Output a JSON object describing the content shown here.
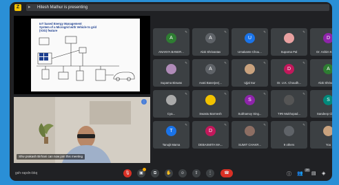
{
  "header": {
    "app_badge": "Z",
    "presenting": "Hitesh Mathur is presenting"
  },
  "slide": {
    "title": "IoT based Energy Management\nSystem of a Microgrid with Vehicle to grid\n(V2G) feature"
  },
  "speaker": {
    "caption": "Shiv prakash Birhani can now join this meeting"
  },
  "participants": [
    {
      "initial": "A",
      "name": "ANANYA BANER...",
      "color": "#2e7d32"
    },
    {
      "initial": "A",
      "name": "Alok Shrivastav",
      "color": "#5f6368"
    },
    {
      "initial": "U",
      "name": "Umakante Chou...",
      "color": "#1a73e8"
    },
    {
      "initial": "",
      "name": "Suparna Pal",
      "color": "#e8a0a0",
      "photo": true
    },
    {
      "initial": "D",
      "name": "Dr. Ashim Kuma...",
      "color": "#8e24aa"
    },
    {
      "initial": "",
      "name": "Suparna Biswas",
      "color": "#b08bb8",
      "photo": true
    },
    {
      "initial": "A",
      "name": "Avati Banerjee(...",
      "color": "#5f6368"
    },
    {
      "initial": "",
      "name": "Ujjal Sur",
      "color": "#c9a27e",
      "photo": true
    },
    {
      "initial": "D",
      "name": "Dr. U.K. Choudh...",
      "color": "#c2185b"
    },
    {
      "initial": "A",
      "name": "Alok Shrivastav",
      "color": "#2e7d32"
    },
    {
      "initial": "",
      "name": "Cya...",
      "color": "#aaaaaa",
      "photo": true
    },
    {
      "initial": "",
      "name": "Swastu Barmesh",
      "color": "#f2c200",
      "photo": true
    },
    {
      "initial": "S",
      "name": "Subhamoy Sing...",
      "color": "#8e24aa"
    },
    {
      "initial": "",
      "name": "TIRI Mukhopad...",
      "color": "#555",
      "photo": true
    },
    {
      "initial": "S",
      "name": "Sandeep Chakr...",
      "color": "#00897b"
    },
    {
      "initial": "T",
      "name": "Tanujit Mama",
      "color": "#1a73e8"
    },
    {
      "initial": "D",
      "name": "DEBASMITA MA...",
      "color": "#c2185b"
    },
    {
      "initial": "",
      "name": "SUMIT CHAKR...",
      "color": "#8d6e63",
      "photo": true
    },
    {
      "initial": "",
      "name": "9 others",
      "color": "#5f6368",
      "photo": true
    },
    {
      "initial": "",
      "name": "You",
      "color": "#c9a27e",
      "photo": true
    }
  ],
  "footer": {
    "meeting_code": "gsh-rapdn-bkq",
    "host_badge": "20"
  },
  "icons": {
    "mic": "mic-off-icon",
    "camera": "camera-icon",
    "captions": "captions-icon",
    "hand": "raise-hand-icon",
    "present": "present-icon",
    "more": "more-icon",
    "end": "end-call-icon",
    "info": "info-icon",
    "people": "people-icon",
    "chat": "chat-icon",
    "activities": "activities-icon"
  }
}
